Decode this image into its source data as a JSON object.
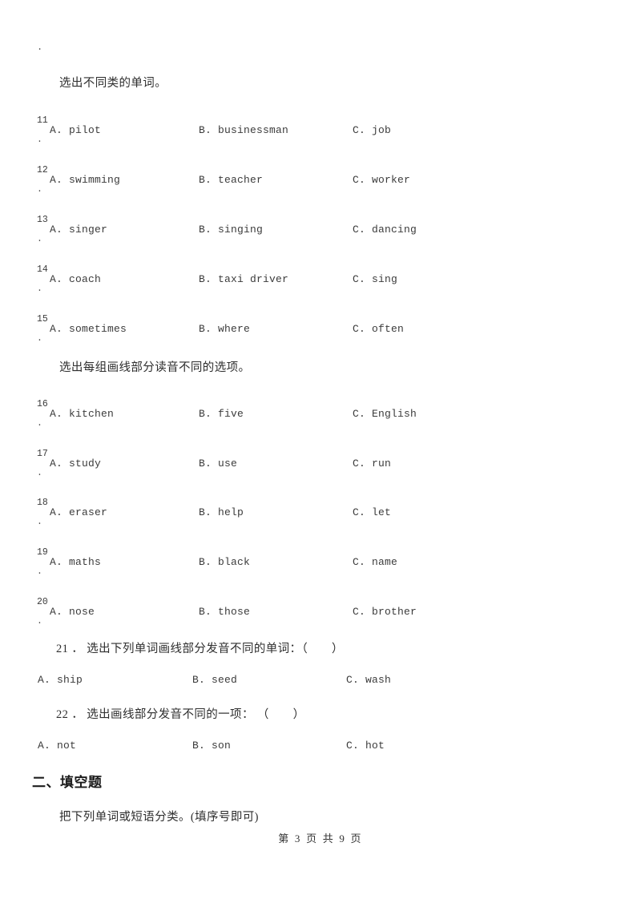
{
  "document": {
    "orphan_marker": ".",
    "footer": "第 3 页 共 9 页"
  },
  "sections": [
    {
      "instruction": "选出不同类的单词。",
      "questions": [
        {
          "number": "11",
          "period": ".",
          "a": "A. pilot",
          "b": "B. businessman",
          "c": "C. job"
        },
        {
          "number": "12",
          "period": ".",
          "a": "A. swimming",
          "b": "B. teacher",
          "c": "C. worker"
        },
        {
          "number": "13",
          "period": ".",
          "a": "A. singer",
          "b": "B. singing",
          "c": "C. dancing"
        },
        {
          "number": "14",
          "period": ".",
          "a": "A. coach",
          "b": "B. taxi driver",
          "c": "C. sing"
        },
        {
          "number": "15",
          "period": ".",
          "a": "A. sometimes",
          "b": "B. where",
          "c": "C. often"
        }
      ]
    },
    {
      "instruction": "选出每组画线部分读音不同的选项。",
      "questions": [
        {
          "number": "16",
          "period": ".",
          "a": "A. kitchen",
          "b": "B. five",
          "c": "C. English"
        },
        {
          "number": "17",
          "period": ".",
          "a": "A. study",
          "b": "B. use",
          "c": "C. run"
        },
        {
          "number": "18",
          "period": ".",
          "a": "A. eraser",
          "b": "B. help",
          "c": "C. let"
        },
        {
          "number": "19",
          "period": ".",
          "a": "A. maths",
          "b": "B. black",
          "c": "C. name"
        },
        {
          "number": "20",
          "period": ".",
          "a": "A. nose",
          "b": "B. those",
          "c": "C. brother"
        }
      ]
    }
  ],
  "inline_questions": [
    {
      "prompt": "21 ． 选出下列单词画线部分发音不同的单词：（　　）",
      "a": "A. ship",
      "b": "B. seed",
      "c": "C. wash"
    },
    {
      "prompt": "22 ． 选出画线部分发音不同的一项： （　　）",
      "a": "A. not",
      "b": "B. son",
      "c": "C. hot"
    }
  ],
  "fill_in_section": {
    "heading": "二、填空题",
    "instruction": "把下列单词或短语分类。(填序号即可)"
  }
}
